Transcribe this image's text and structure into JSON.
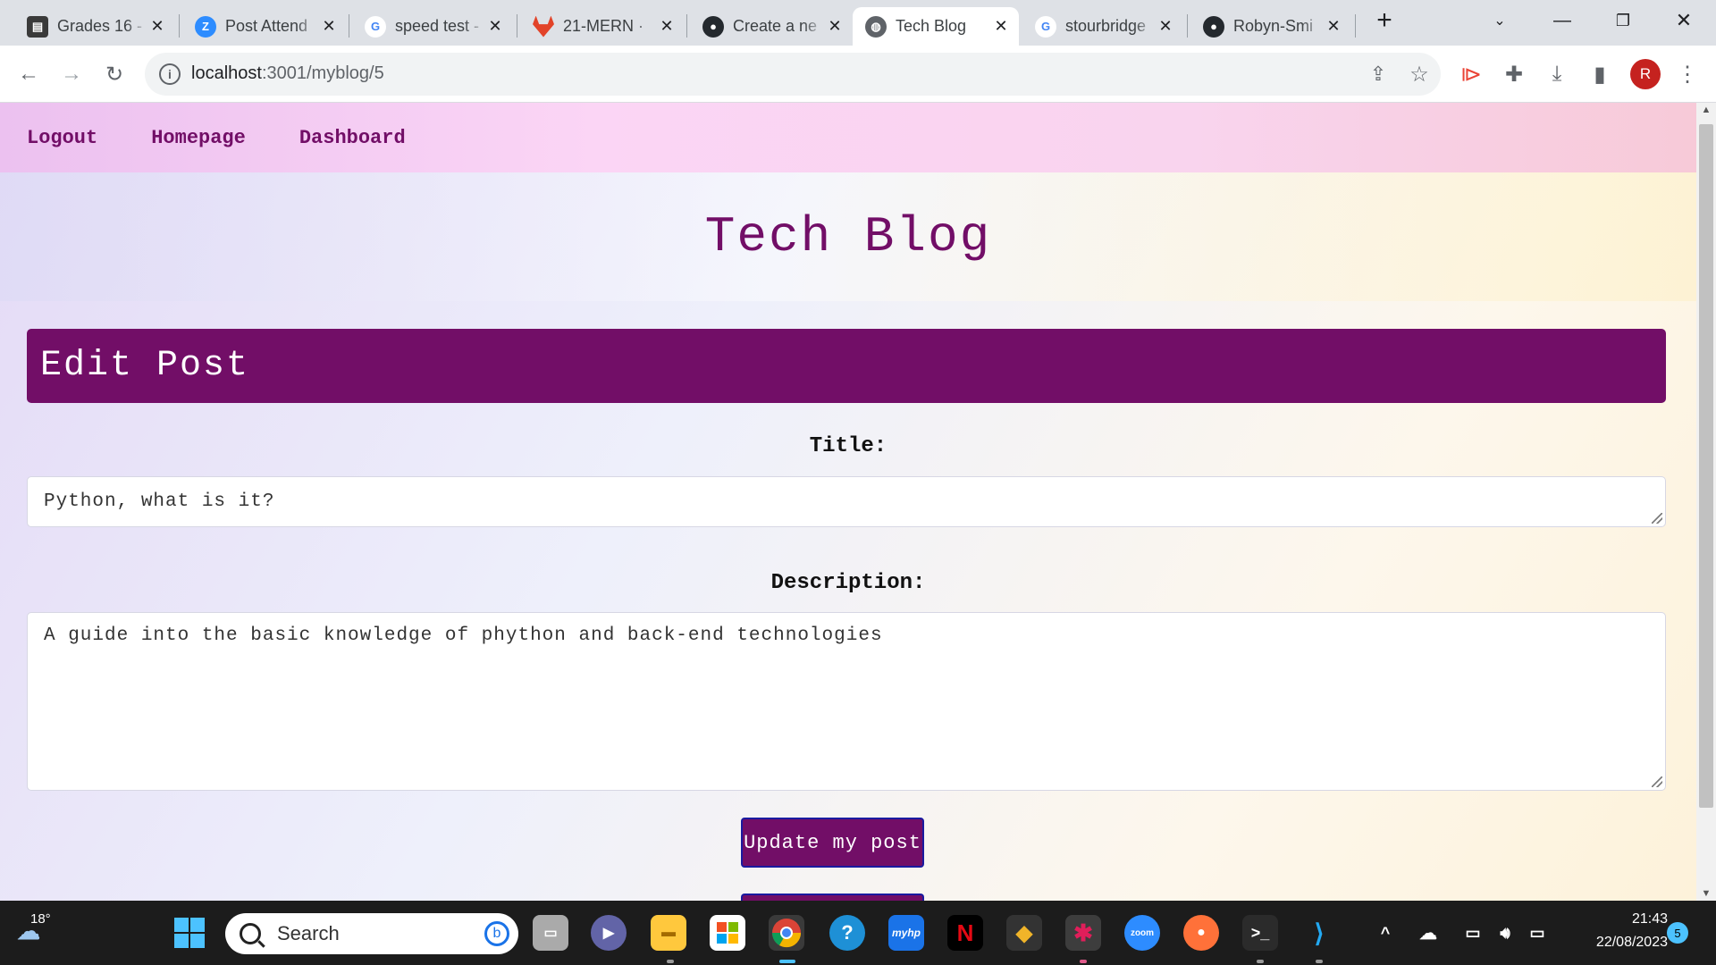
{
  "browser": {
    "tabs": [
      {
        "title": "Grades 16 -",
        "icon": "canvas-icon",
        "color": "#444444"
      },
      {
        "title": "Post Attend",
        "icon": "zoom-z-icon",
        "color": "#2d8cff"
      },
      {
        "title": "speed test -",
        "icon": "google-icon",
        "color": "#4285f4"
      },
      {
        "title": "21-MERN ·",
        "icon": "gitlab-icon",
        "color": "#e24329"
      },
      {
        "title": "Create a ne",
        "icon": "github-icon",
        "color": "#24292e"
      },
      {
        "title": "Tech Blog",
        "icon": "globe-icon",
        "color": "#5f6368",
        "active": true
      },
      {
        "title": "stourbridge",
        "icon": "google-icon",
        "color": "#4285f4"
      },
      {
        "title": "Robyn-Smi",
        "icon": "github-icon",
        "color": "#24292e"
      }
    ],
    "new_tab_symbol": "+",
    "close_symbol": "✕",
    "url_host": "localhost",
    "url_path": ":3001/myblog/5",
    "profile_initial": "R"
  },
  "site": {
    "nav": [
      "Logout",
      "Homepage",
      "Dashboard"
    ],
    "title": "Tech Blog",
    "accent": "#720e67"
  },
  "form": {
    "heading": "Edit Post",
    "title_label": "Title:",
    "title_value": "Python, what is it?",
    "description_label": "Description:",
    "description_value": "A guide into the basic knowledge of phython and back-end technologies",
    "update_button": "Update my post"
  },
  "taskbar": {
    "weather_temp": "18°",
    "search_placeholder": "Search",
    "time": "21:43",
    "date": "22/08/2023",
    "notification_count": "5",
    "zoom_label": "zoom",
    "myhp_label": "myhp"
  }
}
